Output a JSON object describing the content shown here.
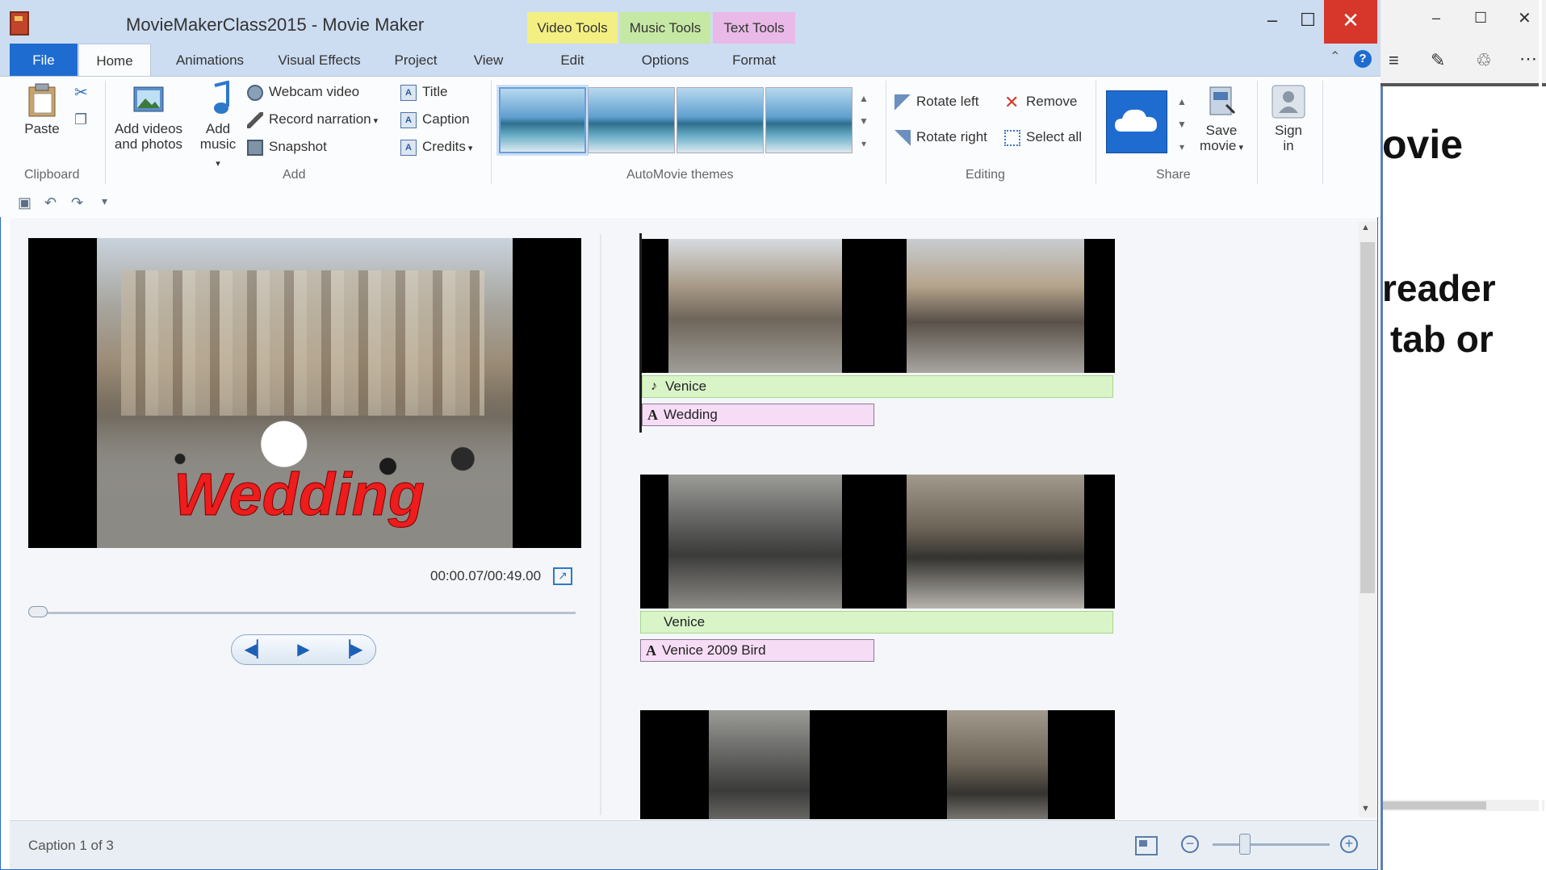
{
  "window": {
    "title": "MovieMakerClass2015 - Movie Maker",
    "context_tabs": [
      "Video Tools",
      "Music Tools",
      "Text Tools"
    ],
    "controls": {
      "minimize": "–",
      "maximize": "☐",
      "close": "✕"
    }
  },
  "tabs": [
    "File",
    "Home",
    "Animations",
    "Visual Effects",
    "Project",
    "View",
    "Edit",
    "Options",
    "Format"
  ],
  "ribbon": {
    "clipboard": {
      "paste": "Paste",
      "label": "Clipboard"
    },
    "add": {
      "add_videos": [
        "Add videos",
        "and photos"
      ],
      "add_music": [
        "Add",
        "music"
      ],
      "webcam": "Webcam video",
      "narration": "Record narration",
      "snapshot": "Snapshot",
      "title": "Title",
      "caption": "Caption",
      "credits": "Credits",
      "label": "Add"
    },
    "themes": {
      "label": "AutoMovie themes"
    },
    "editing": {
      "rotate_left": "Rotate left",
      "rotate_right": "Rotate right",
      "remove": "Remove",
      "select_all": "Select all",
      "label": "Editing"
    },
    "share": {
      "save_movie": [
        "Save",
        "movie"
      ],
      "sign_in": [
        "Sign",
        "in"
      ],
      "label": "Share"
    }
  },
  "preview": {
    "caption_overlay": "Wedding",
    "timecode": "00:00.07/00:49.00",
    "seek_progress": 0.0
  },
  "storyboard": {
    "rows": [
      {
        "music": "Venice",
        "text": "Wedding"
      },
      {
        "music": "Venice",
        "text": "Venice 2009 Bird"
      }
    ]
  },
  "status": {
    "text": "Caption 1 of 3",
    "zoom_level": 0.25
  },
  "side_window": {
    "lines": [
      "ovie",
      "reader",
      "tab or"
    ]
  },
  "colors": {
    "file_tab": "#1f6cd1",
    "video_tools": "#f3ef83",
    "music_tools": "#c6e8a5",
    "text_tools": "#e9b9e7",
    "close": "#d7362b",
    "caption_red": "#ee1c1c"
  }
}
